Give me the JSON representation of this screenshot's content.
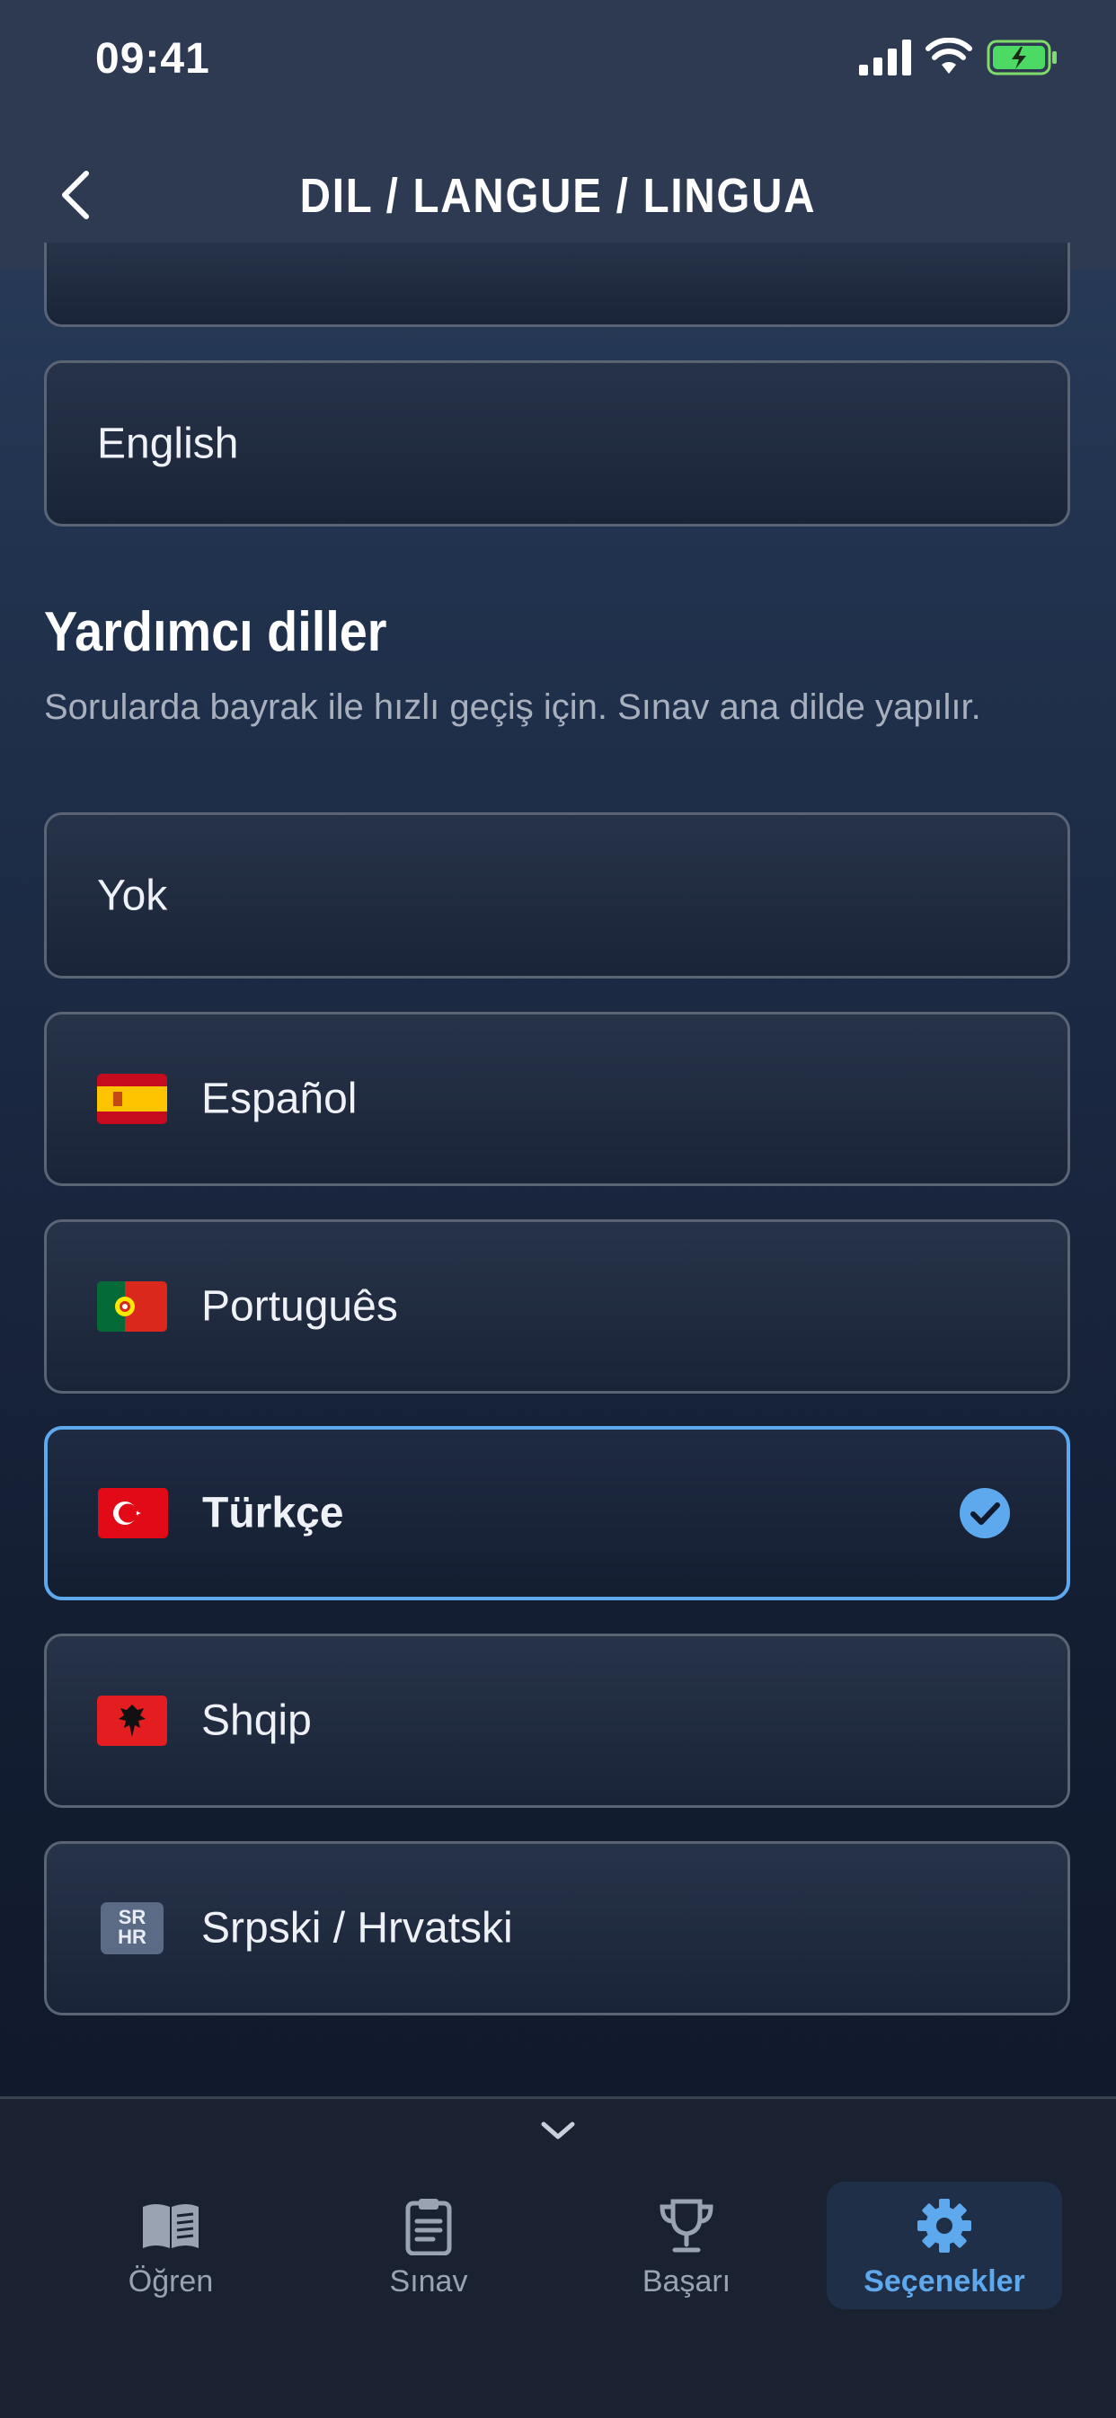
{
  "status_bar": {
    "time": "09:41"
  },
  "header": {
    "title": "DIL / LANGUE / LINGUA"
  },
  "primary_languages": [
    {
      "label": "English"
    }
  ],
  "aux_section": {
    "title": "Yardımcı diller",
    "description": "Sorularda bayrak ile hızlı geçiş için. Sınav ana dilde yapılır."
  },
  "aux_languages": [
    {
      "label": "Yok",
      "flag": "none",
      "selected": false
    },
    {
      "label": "Español",
      "flag": "spain-flag",
      "selected": false
    },
    {
      "label": "Português",
      "flag": "portugal-flag",
      "selected": false
    },
    {
      "label": "Türkçe",
      "flag": "turkey-flag",
      "selected": true
    },
    {
      "label": "Shqip",
      "flag": "albania-flag",
      "selected": false
    },
    {
      "label": "Srpski / Hrvatski",
      "flag": "sr-hr-badge",
      "badge_top": "SR",
      "badge_bottom": "HR",
      "selected": false
    }
  ],
  "tabs": [
    {
      "label": "Öğren",
      "icon": "book-icon",
      "active": false
    },
    {
      "label": "Sınav",
      "icon": "clipboard-icon",
      "active": false
    },
    {
      "label": "Başarı",
      "icon": "trophy-icon",
      "active": false
    },
    {
      "label": "Seçenekler",
      "icon": "gear-icon",
      "active": true
    }
  ],
  "colors": {
    "accent": "#5ea8ee",
    "card_border": "#5b6475",
    "header_bg": "#2d3a52"
  }
}
